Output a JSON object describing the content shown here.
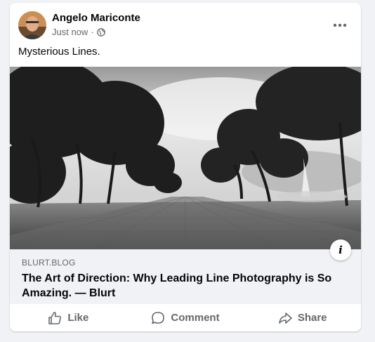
{
  "post": {
    "author": "Angelo Mariconte",
    "time": "Just now",
    "separator": "·",
    "text": "Mysterious Lines.",
    "audience_icon": "globe-icon",
    "more_icon": "more-options-icon"
  },
  "link_preview": {
    "domain": "BLURT.BLOG",
    "title": "The Art of Direction: Why Leading Line Photography is So Amazing. — Blurt",
    "info_label": "i"
  },
  "actions": {
    "like_label": "Like",
    "comment_label": "Comment",
    "share_label": "Share"
  },
  "colors": {
    "secondary_text": "#65676b",
    "card_background": "#ffffff",
    "link_background": "#f0f2f5"
  }
}
